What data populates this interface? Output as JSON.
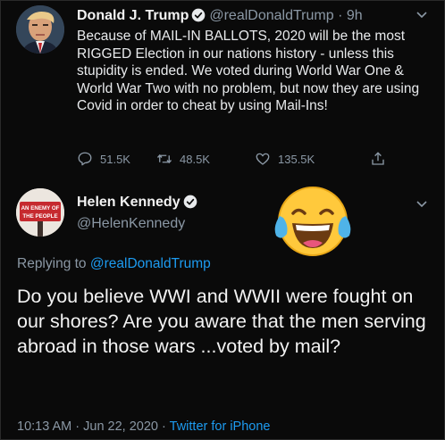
{
  "tweet": {
    "author_name": "Donald J. Trump",
    "handle": "@realDonaldTrump",
    "separator": "·",
    "time": "9h",
    "text": "Because of MAIL-IN BALLOTS, 2020 will be the most RIGGED Election in our nations history - unless this stupidity is ended. We voted during World War One & World War Two with no problem, but now they are using Covid in order to cheat by using Mail-Ins!",
    "replies": "51.5K",
    "retweets": "48.5K",
    "likes": "135.5K"
  },
  "reply": {
    "author_name": "Helen Kennedy",
    "handle": "@HelenKennedy",
    "avatar_text_line1": "AN ENEMY OF",
    "avatar_text_line2": "THE PEOPLE",
    "emoji": "face-with-tears-of-joy",
    "replying_prefix": "Replying to",
    "replying_to": "@realDonaldTrump",
    "text": "Do you believe WWI and WWII were fought on our shores? Are you aware that the men serving abroad in those wars ...voted by mail?",
    "timestamp": "10:13 AM · Jun 22, 2020 ·",
    "source": "Twitter for iPhone"
  },
  "colors": {
    "background": "#0a0a0a",
    "link": "#1d9bf0",
    "muted": "#8b98a5",
    "verified": "#e8eaec"
  }
}
